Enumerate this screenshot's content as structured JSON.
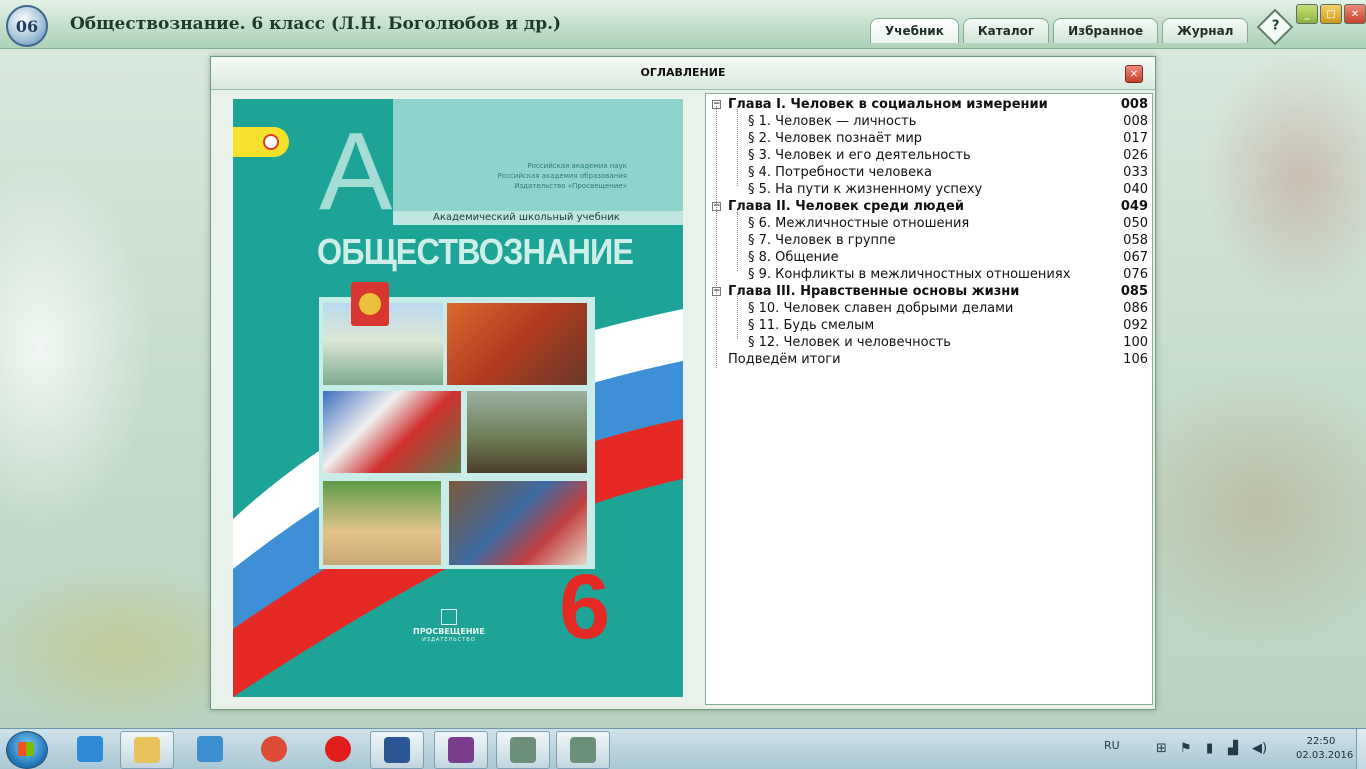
{
  "window": {
    "logo_text": "06",
    "title": "Обществознание. 6 класс (Л.Н. Боголюбов и др.)",
    "tabs": [
      {
        "label": "Учебник",
        "active": true
      },
      {
        "label": "Каталог",
        "active": false
      },
      {
        "label": "Избранное",
        "active": false
      },
      {
        "label": "Журнал",
        "active": false
      }
    ],
    "help_label": "?"
  },
  "dialog": {
    "title": "ОГЛАВЛЕНИЕ",
    "close_glyph": "✕"
  },
  "cover": {
    "big_letter": "А",
    "publisher_lines": [
      "Российская академия наук",
      "Российская академия образования",
      "Издательство «Просвещение»"
    ],
    "series": "Академический школьный учебник",
    "subject": "ОБЩЕСТВОЗНАНИЕ",
    "grade": "6",
    "publisher_name": "ПРОСВЕЩЕНИЕ",
    "publisher_sub": "ИЗДАТЕЛЬСТВО",
    "colors": {
      "teal": "#1ea496",
      "light_teal": "#8fd3cc",
      "red": "#e52a25",
      "blue": "#3e8fd6"
    }
  },
  "toc": [
    {
      "type": "chapter",
      "label": "Глава I. Человек в социальном измерении",
      "page": "008"
    },
    {
      "type": "section",
      "label": "§ 1. Человек — личность",
      "page": "008"
    },
    {
      "type": "section",
      "label": "§ 2. Человек познаёт мир",
      "page": "017"
    },
    {
      "type": "section",
      "label": "§ 3. Человек и его деятельность",
      "page": "026"
    },
    {
      "type": "section",
      "label": "§ 4. Потребности человека",
      "page": "033"
    },
    {
      "type": "section",
      "label": "§ 5. На пути к жизненному успеху",
      "page": "040"
    },
    {
      "type": "chapter",
      "label": "Глава II. Человек среди людей",
      "page": "049"
    },
    {
      "type": "section",
      "label": "§ 6. Межличностные отношения",
      "page": "050"
    },
    {
      "type": "section",
      "label": "§ 7. Человек в группе",
      "page": "058"
    },
    {
      "type": "section",
      "label": "§ 8. Общение",
      "page": "067"
    },
    {
      "type": "section",
      "label": "§ 9. Конфликты в межличностных отношениях",
      "page": "076"
    },
    {
      "type": "chapter",
      "label": "Глава III. Нравственные основы жизни",
      "page": "085"
    },
    {
      "type": "section",
      "label": "§ 10. Человек славен добрыми делами",
      "page": "086"
    },
    {
      "type": "section",
      "label": "§ 11. Будь  смелым",
      "page": "092"
    },
    {
      "type": "section",
      "label": "§ 12. Человек и человечность",
      "page": "100"
    },
    {
      "type": "leaf",
      "label": "Подведём итоги",
      "page": "106"
    }
  ],
  "taskbar": {
    "apps": [
      {
        "name": "internet-explorer-icon",
        "color": "#2f8ad8"
      },
      {
        "name": "file-explorer-icon",
        "color": "#e8c25a"
      },
      {
        "name": "media-player-icon",
        "color": "#3c8fd0"
      },
      {
        "name": "chrome-icon",
        "color": "#dd4b39"
      },
      {
        "name": "yandex-browser-icon",
        "color": "#e01c1c"
      },
      {
        "name": "word-icon",
        "color": "#2b5797"
      },
      {
        "name": "winrar-icon",
        "color": "#7a3c8c"
      },
      {
        "name": "app-window-icon",
        "color": "#6c8f7a"
      },
      {
        "name": "app-window-icon-2",
        "color": "#6c8f7a"
      }
    ],
    "language": "RU",
    "time": "22:50",
    "date": "02.03.2016"
  }
}
